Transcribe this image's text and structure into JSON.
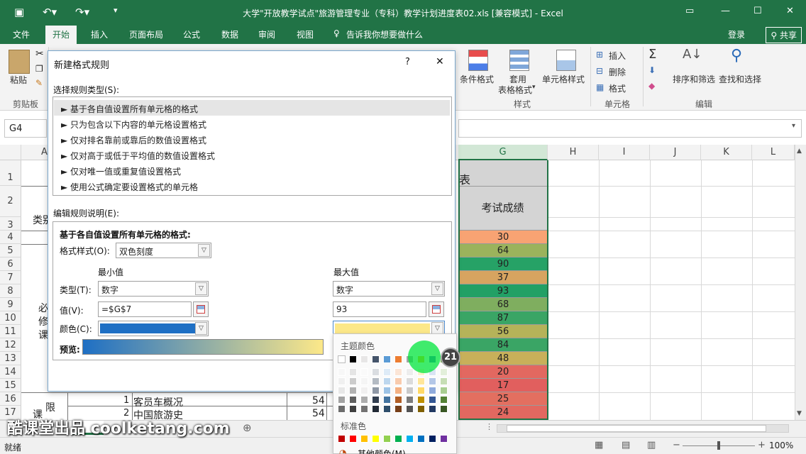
{
  "window": {
    "title": "大学\"开放教学试点\"旅游管理专业（专科）教学计划进度表02.xls  [兼容模式] - Excel",
    "save_icon": "save-icon",
    "login": "登录",
    "share": "共享"
  },
  "tabs": [
    "文件",
    "开始",
    "插入",
    "页面布局",
    "公式",
    "数据",
    "审阅",
    "视图",
    "告诉我你想要做什么"
  ],
  "ribbon": {
    "paste": "粘贴",
    "clipboard_group": "剪贴板",
    "cond_format": "条件格式",
    "table_format_1": "套用",
    "table_format_2": "表格格式",
    "cell_style": "单元格样式",
    "style_group": "样式",
    "insert": "插入",
    "delete": "删除",
    "format": "格式",
    "cells_group": "单元格",
    "sort_filter": "排序和筛选",
    "find_select": "查找和选择",
    "edit_group": "编辑",
    "sigma": "Σ"
  },
  "formula_bar": {
    "name_box": "G4"
  },
  "columns": [
    "A",
    "G",
    "H",
    "I",
    "J",
    "K",
    "L"
  ],
  "rows": [
    "1",
    "2",
    "3",
    "4",
    "5",
    "6",
    "7",
    "8",
    "9",
    "10",
    "11",
    "12",
    "13",
    "14",
    "15",
    "16",
    "17"
  ],
  "sheet": {
    "a3": "类别",
    "a9": "必",
    "a10": "修",
    "a11": "课",
    "a17_1": "限",
    "a17_2": "课",
    "g1_partial": "表",
    "g_header": "考试成绩",
    "scores": [
      "30",
      "64",
      "90",
      "37",
      "93",
      "68",
      "87",
      "56",
      "84",
      "48",
      "20",
      "17",
      "25",
      "24"
    ],
    "score_colors": [
      "#f8a373",
      "#9bb35c",
      "#26a266",
      "#d7a460",
      "#22a065",
      "#7fae5f",
      "#3aa565",
      "#b5b359",
      "#3aa565",
      "#c8b05a",
      "#e26860",
      "#e15f5e",
      "#e36f60",
      "#e26860"
    ],
    "row16_num": "1",
    "row16_course": "客员车概况",
    "row16_val": "54",
    "row17_num": "2",
    "row17_course": "中国旅游史",
    "row17_val": "54"
  },
  "status": {
    "ready": "就绪",
    "zoom": "100%"
  },
  "dialog": {
    "title": "新建格式规则",
    "help": "?",
    "close": "✕",
    "select_type_label": "选择规则类型(S):",
    "rules": [
      "► 基于各自值设置所有单元格的格式",
      "► 只为包含以下内容的单元格设置格式",
      "► 仅对排名靠前或靠后的数值设置格式",
      "► 仅对高于或低于平均值的数值设置格式",
      "► 仅对唯一值或重复值设置格式",
      "► 使用公式确定要设置格式的单元格"
    ],
    "edit_desc_label": "编辑规则说明(E):",
    "desc_title": "基于各自值设置所有单元格的格式:",
    "format_style_label": "格式样式(O):",
    "format_style_value": "双色刻度",
    "min_label": "最小值",
    "max_label": "最大值",
    "type_label": "类型(T):",
    "min_type": "数字",
    "max_type": "数字",
    "value_label": "值(V):",
    "min_value": "=$G$7",
    "max_value": "93",
    "color_label": "颜色(C):",
    "min_color": "#1e6fc4",
    "max_color": "#fce889",
    "preview_label": "预览:"
  },
  "picker": {
    "theme_label": "主题颜色",
    "standard_label": "标准色",
    "more_label": "其他颜色(M)...",
    "badge": "21",
    "theme_row": [
      "#ffffff",
      "#000000",
      "#e7e6e6",
      "#44546a",
      "#5b9bd5",
      "#ed7d31",
      "#a5a5a5",
      "#ffc000",
      "#4472c4",
      "#70ad47"
    ],
    "standard_row": [
      "#c00000",
      "#ff0000",
      "#ffc000",
      "#ffff00",
      "#92d050",
      "#00b050",
      "#00b0f0",
      "#0070c0",
      "#002060",
      "#7030a0"
    ]
  },
  "watermark": "酷课堂出品  coolketang.com"
}
